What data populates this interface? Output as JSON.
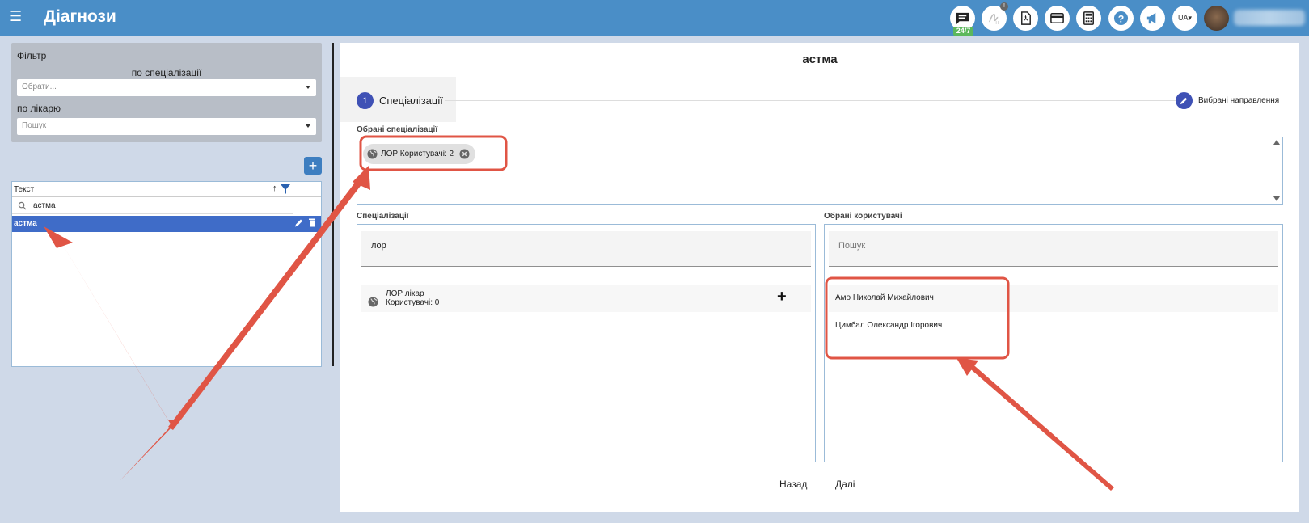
{
  "header": {
    "menu_icon": "☰",
    "title": "Діагнози",
    "chat_badge": "24/7",
    "notif_count": "!",
    "language": "UA▾"
  },
  "filter": {
    "title": "Фільтр",
    "by_specialization_label": "по спеціалізації",
    "specialization_placeholder": "Обрати...",
    "by_doctor_label": "по лікарю",
    "doctor_placeholder": "Пошук"
  },
  "grid": {
    "column_header": "Текст",
    "search_value": "астма",
    "rows": [
      {
        "text": "астма",
        "selected": true
      }
    ]
  },
  "main": {
    "title": "астма",
    "steps": [
      {
        "number": "1",
        "label": "Спеціалізації",
        "active": true
      },
      {
        "number": "",
        "label": "Вибрані направлення",
        "active": false
      }
    ],
    "selected_specializations_label": "Обрані спеціалізації",
    "chips": [
      {
        "label": "ЛОР Користувачі: 2"
      }
    ],
    "specializations": {
      "label": "Спеціалізації",
      "search_value": "лор",
      "items": [
        {
          "name": "ЛОР лікар",
          "users": "Користувачі: 0"
        }
      ]
    },
    "selected_users": {
      "label": "Обрані користувачі",
      "search_placeholder": "Пошук",
      "items": [
        {
          "name": "Амо Николай Михайлович"
        },
        {
          "name": "Цимбал Олександр Ігорович"
        }
      ]
    },
    "back_label": "Назад",
    "next_label": "Далі"
  },
  "colors": {
    "topbar": "#4a8ec7",
    "selected_row": "#3f6cc8",
    "step_circle": "#3f51b5",
    "annotation": "#e05545"
  }
}
